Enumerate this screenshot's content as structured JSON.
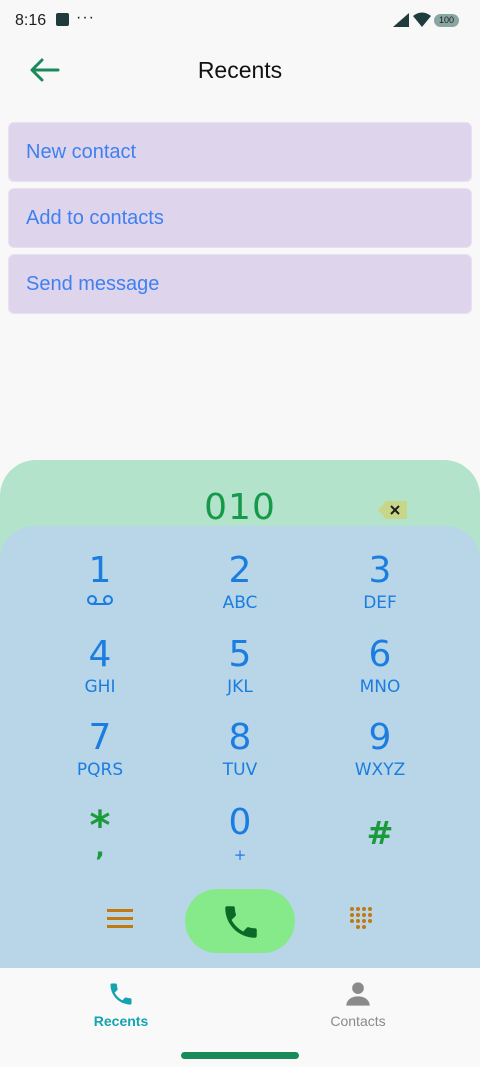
{
  "status_bar": {
    "time": "8:16",
    "more": "···",
    "battery": "100",
    "icons": [
      "app-square-icon",
      "signal-icon",
      "wifi-icon",
      "battery-icon"
    ]
  },
  "header": {
    "title": "Recents",
    "back_icon": "arrow-left-icon"
  },
  "actions": [
    "New contact",
    "Add to contacts",
    "Send message"
  ],
  "dialer": {
    "number": "010",
    "keys": [
      {
        "digit": "1",
        "letters": ""
      },
      {
        "digit": "2",
        "letters": "ABC"
      },
      {
        "digit": "3",
        "letters": "DEF"
      },
      {
        "digit": "4",
        "letters": "GHI"
      },
      {
        "digit": "5",
        "letters": "JKL"
      },
      {
        "digit": "6",
        "letters": "MNO"
      },
      {
        "digit": "7",
        "letters": "PQRS"
      },
      {
        "digit": "8",
        "letters": "TUV"
      },
      {
        "digit": "9",
        "letters": "WXYZ"
      },
      {
        "digit": "*",
        "letters": ","
      },
      {
        "digit": "0",
        "letters": "+"
      },
      {
        "digit": "#",
        "letters": ""
      }
    ],
    "colors": {
      "digits": "#1c7de0",
      "symbols": "#1a9a3a",
      "call": "#86ea8a",
      "accent": "#c07a10"
    }
  },
  "bottom_nav": {
    "items": [
      {
        "label": "Recents",
        "active": true,
        "icon": "phone-icon"
      },
      {
        "label": "Contacts",
        "active": false,
        "icon": "person-icon"
      }
    ],
    "active_color": "#14a3b0",
    "inactive_color": "#8a8a8a"
  }
}
